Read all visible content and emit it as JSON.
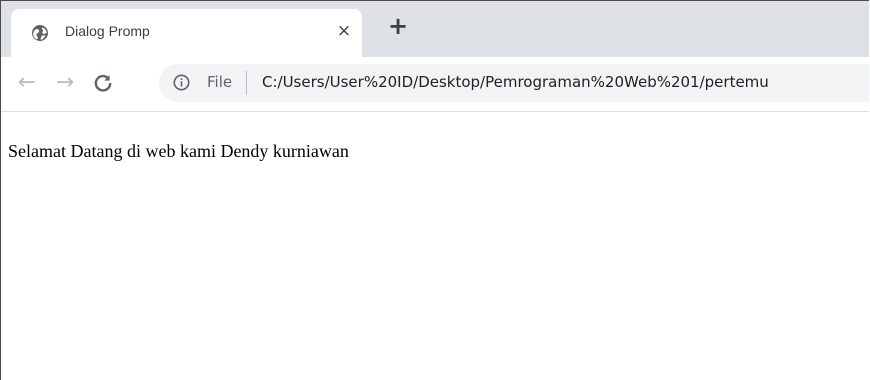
{
  "tab": {
    "title": "Dialog Promp",
    "close_glyph": "×",
    "favicon": "globe-icon"
  },
  "new_tab_glyph": "+",
  "toolbar": {
    "back_glyph": "←",
    "forward_glyph": "→",
    "reload_glyph": "C",
    "info_icon": "info-icon",
    "scheme_label": "File",
    "url": "C:/Users/User%20ID/Desktop/Pemrograman%20Web%201/pertemu"
  },
  "page": {
    "message": "Selamat Datang di web kami Dendy kurniawan"
  },
  "colors": {
    "tabstrip": "#dee1e6",
    "omnibox": "#f1f3f4",
    "inactive_nav": "#b8bbbf",
    "text": "#202124"
  }
}
